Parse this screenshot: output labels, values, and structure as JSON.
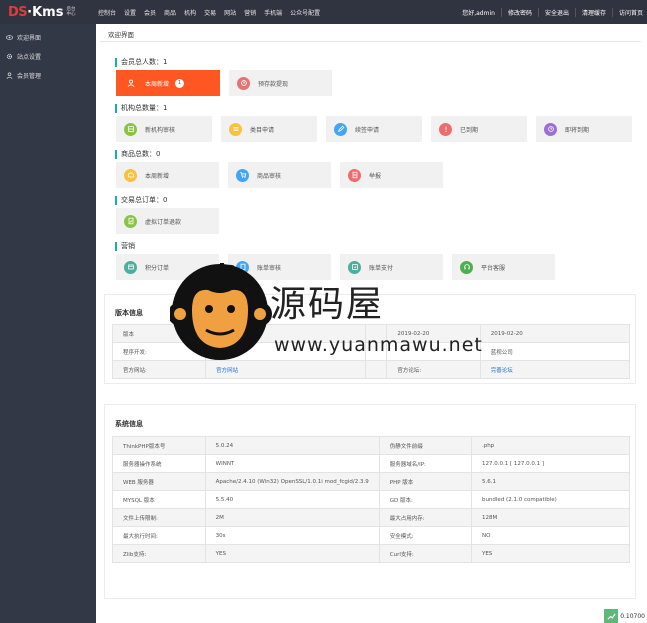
{
  "header": {
    "logo_ds": "DS",
    "logo_kms": "·Kms",
    "logo_sub1": "后台",
    "logo_sub2": "中心",
    "nav": [
      "控制台",
      "设置",
      "会员",
      "商品",
      "机构",
      "交易",
      "网站",
      "营销",
      "手机端",
      "公众号配置"
    ],
    "right": [
      "您好,admin",
      "修改密码",
      "安全退出",
      "清理缓存",
      "访问首页"
    ]
  },
  "sidebar": {
    "items": [
      {
        "label": "欢迎界面",
        "icon": "eye-icon"
      },
      {
        "label": "站点设置",
        "icon": "gear-icon"
      },
      {
        "label": "会员管理",
        "icon": "user-icon"
      }
    ]
  },
  "main": {
    "tab": "欢迎界面",
    "sections": [
      {
        "title": "会员总人数：1",
        "tiles": [
          {
            "label": "本周新增",
            "badge": "1",
            "icon": "user-icon",
            "color": "#ffffff",
            "active": true
          },
          {
            "label": "预存款提现",
            "icon": "wallet-icon",
            "color": "#e57373"
          }
        ]
      },
      {
        "title": "机构总数量：1",
        "tiles": [
          {
            "label": "新机构审核",
            "icon": "store-icon",
            "color": "#8bc34a"
          },
          {
            "label": "类目申请",
            "icon": "list-icon",
            "color": "#f5c242"
          },
          {
            "label": "续签申请",
            "icon": "pencil-icon",
            "color": "#42a5f5"
          },
          {
            "label": "已到期",
            "icon": "alert-icon",
            "color": "#ef6c6c"
          },
          {
            "label": "即将到期",
            "icon": "clock-icon",
            "color": "#9c6fd6"
          }
        ]
      },
      {
        "title": "商品总数：0",
        "tiles": [
          {
            "label": "本周新增",
            "icon": "box-icon",
            "color": "#f5c242"
          },
          {
            "label": "商品审核",
            "icon": "cart-icon",
            "color": "#42a5f5"
          },
          {
            "label": "举报",
            "icon": "doc-icon",
            "color": "#ef6c6c"
          }
        ]
      },
      {
        "title": "交易总订单：0",
        "tiles": [
          {
            "label": "虚拟订单退款",
            "icon": "refund-icon",
            "color": "#8bc34a"
          }
        ]
      },
      {
        "title": "营销",
        "tiles": [
          {
            "label": "积分订单",
            "icon": "points-icon",
            "color": "#4caf9b"
          },
          {
            "label": "账单审核",
            "icon": "bill-icon",
            "color": "#42a5f5"
          },
          {
            "label": "账单支付",
            "icon": "pay-icon",
            "color": "#4caf9b"
          },
          {
            "label": "平台客服",
            "icon": "service-icon",
            "color": "#4caf50"
          }
        ]
      }
    ],
    "version": {
      "title": "版本信息",
      "rows": [
        [
          "版本",
          "",
          "",
          "2019-02-20",
          "2019-02-20"
        ],
        [
          "程序开发:",
          "",
          "",
          "",
          "蓝视公司"
        ],
        [
          "官方网站:",
          "官方网站",
          "",
          "官方论坛:",
          "完善论坛"
        ]
      ]
    },
    "system": {
      "title": "系统信息",
      "rows": [
        [
          "ThinkPHP版本号",
          "5.0.24",
          "伪静文件前缀",
          ".php"
        ],
        [
          "服务器操作系统",
          "WINNT",
          "服务器域名/IP:",
          "127.0.0.1 [ 127.0.0.1 ]"
        ],
        [
          "WEB 服务器",
          "Apache/2.4.10 (Win32) OpenSSL/1.0.1i mod_fcgid/2.3.9",
          "PHP 版本",
          "5.6.1"
        ],
        [
          "MYSQL 版本",
          "5.5.40",
          "GD 版本:",
          "bundled (2.1.0 compatible)"
        ],
        [
          "文件上传限制:",
          "2M",
          "最大占用内存:",
          "128M"
        ],
        [
          "最大执行时间:",
          "30s",
          "安全模式:",
          "NO"
        ],
        [
          "Zlib支持:",
          "YES",
          "Curl支持:",
          "YES"
        ]
      ]
    }
  },
  "watermark": {
    "name": "源码屋",
    "url": "www.yuanmawu.net"
  },
  "footer": {
    "value": "0.10700"
  },
  "colors": {
    "topbar": "#2f3440",
    "sidebar": "#333846",
    "accent": "#ff5722",
    "link": "#1e6fd9",
    "section_bar": "#16b0a4"
  }
}
